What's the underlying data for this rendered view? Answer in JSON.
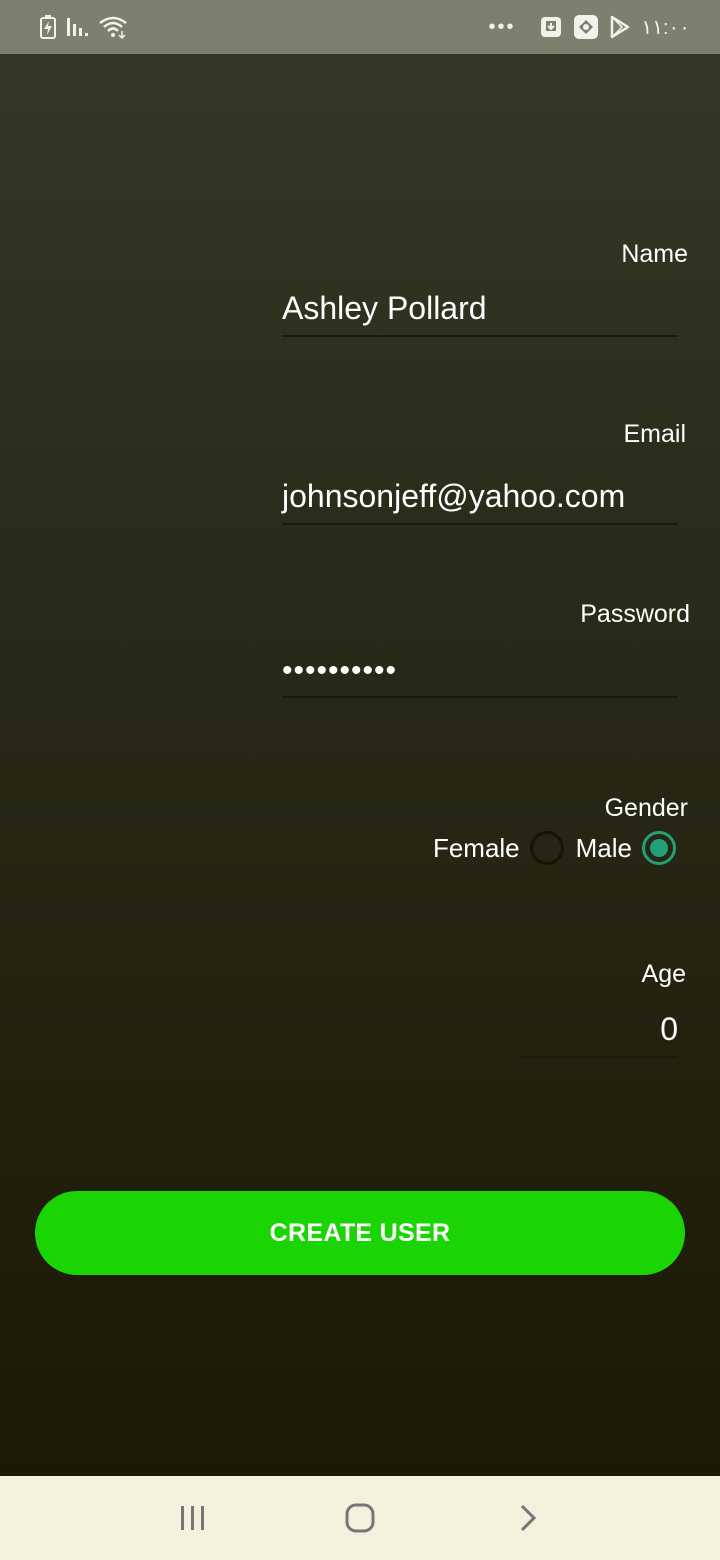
{
  "status_bar": {
    "time": "١١:٠٠",
    "overflow": "•••",
    "icons": [
      "battery-charging-icon",
      "signal-icon",
      "wifi-icon",
      "download-icon",
      "app-icon",
      "play-store-icon"
    ]
  },
  "form": {
    "name": {
      "label": "Name",
      "value": "Ashley Pollard"
    },
    "email": {
      "label": "Email",
      "value": "johnsonjeff@yahoo.com"
    },
    "password": {
      "label": "Password",
      "value": "••••••••••"
    },
    "gender": {
      "label": "Gender",
      "options": [
        {
          "label": "Female",
          "selected": false
        },
        {
          "label": "Male",
          "selected": true
        }
      ]
    },
    "age": {
      "label": "Age",
      "value": "0"
    }
  },
  "create_button": {
    "label": "CREATE USER"
  },
  "colors": {
    "accent_button": "#1bd403",
    "radio_checked": "#23a07a",
    "status_bar": "#7f7f6e",
    "nav_bar": "#f3f0dc"
  },
  "nav_bar": {
    "icons": [
      "recent-apps-icon",
      "home-icon",
      "back-icon"
    ]
  }
}
